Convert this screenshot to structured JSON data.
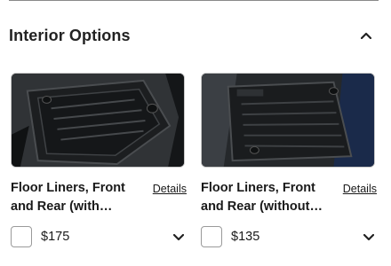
{
  "section": {
    "title": "Interior Options"
  },
  "products": [
    {
      "name": "Floor Liners, Front and Rear (with…",
      "details_label": "Details",
      "price": "$175"
    },
    {
      "name": "Floor Liners, Front and Rear (without…",
      "details_label": "Details",
      "price": "$135"
    }
  ],
  "icons": {
    "collapse": "chevron-up-icon",
    "expand": "chevron-down-icon"
  }
}
